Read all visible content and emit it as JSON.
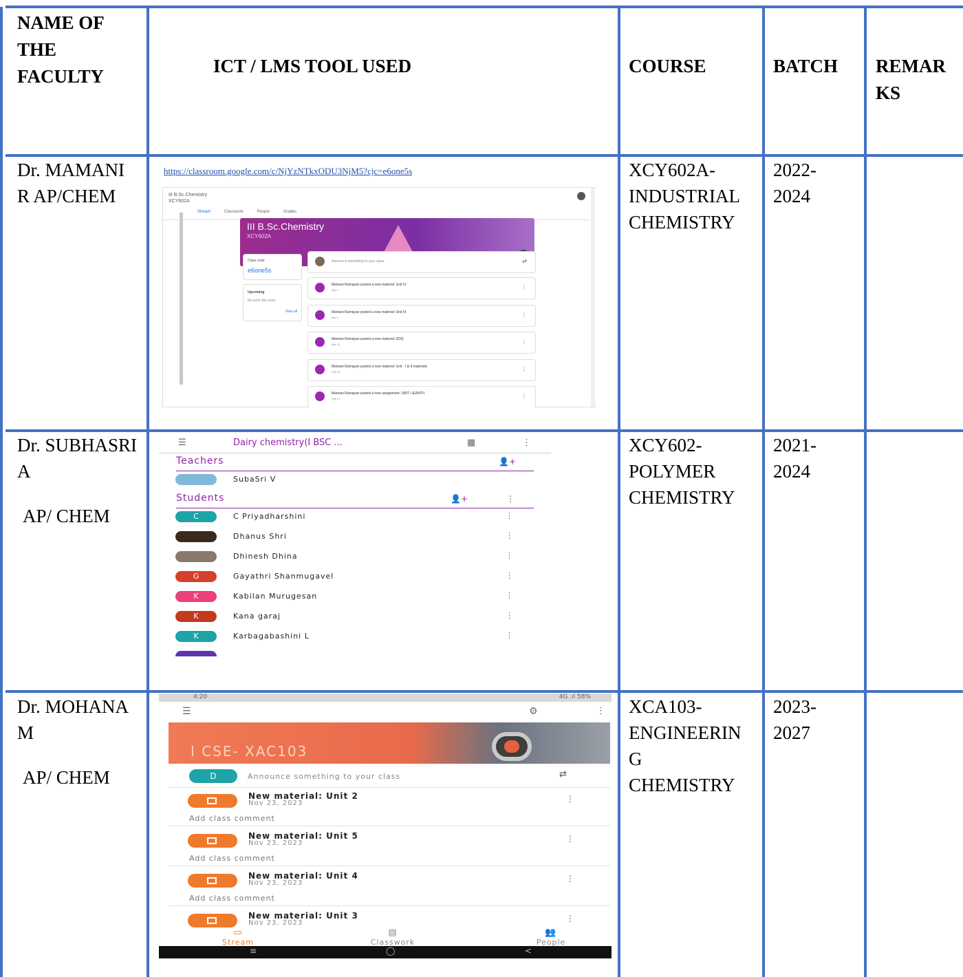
{
  "headers": {
    "faculty": "NAME OF THE FACULTY",
    "tool": "ICT / LMS TOOL USED",
    "course": "COURSE",
    "batch": "BATCH",
    "remarks": "REMAR KS"
  },
  "rows": [
    {
      "faculty_line1": "Dr. MAMANI R AP/CHEM",
      "faculty_line2": "",
      "course": "XCY602A-INDUSTRIAL CHEMISTRY",
      "batch": "2022-2024",
      "remarks": ""
    },
    {
      "faculty_line1": "Dr. SUBHASRI A",
      "faculty_line2": "AP/ CHEM",
      "course": "XCY602-POLYMER CHEMISTRY",
      "batch": "2021-2024",
      "remarks": ""
    },
    {
      "faculty_line1": "Dr. MOHANA M",
      "faculty_line2": "AP/ CHEM",
      "course": "XCA103-ENGINEERIN G CHEMISTRY",
      "batch": "2023-2027",
      "remarks": ""
    }
  ],
  "shot1": {
    "url": "https://classroom.google.com/c/NjYzNTkxODU3NjM5?cjc=e6one5s",
    "class_top": "III B.Sc.Chemistry",
    "class_top_code": "XCY602A",
    "tabs": [
      "Stream",
      "Classwork",
      "People",
      "Grades"
    ],
    "banner_title": "III B.Sc.Chemistry",
    "banner_code": "XCY602A",
    "class_code_label": "Class code",
    "class_code": "e6one5s",
    "upcoming_label": "Upcoming",
    "upcoming_note": "No work due soon",
    "view_all": "View all",
    "announce": "Announce something to your class",
    "posts": [
      {
        "text": "Mamani Ramayan posted a new material: Unit IV",
        "date": "Apr 2"
      },
      {
        "text": "Mamani Ramayan posted a new material: Unit III",
        "date": "Apr 2"
      },
      {
        "text": "Mamani Ramayan posted a new material: DDQ",
        "date": "Mar 21"
      },
      {
        "text": "Mamani Ramayan posted a new material: Unit - I & II materials",
        "date": "Feb 20"
      },
      {
        "text": "Mamani Ramayan posted a new assignment: UNIT I &UNITII",
        "date": "Feb 17"
      }
    ]
  },
  "shot2": {
    "title": "Dairy chemistry(I BSC ...",
    "teachers_label": "Teachers",
    "teacher": "SubaSri V",
    "students_label": "Students",
    "students": [
      {
        "initial": "C",
        "name": "C Priyadharshini",
        "color": "#1ea3a6"
      },
      {
        "initial": "",
        "name": "Dhanus Shri",
        "color": "#3a2a1e"
      },
      {
        "initial": "",
        "name": "Dhinesh Dhina",
        "color": "#8a7a6e"
      },
      {
        "initial": "G",
        "name": "Gayathri Shanmugavel",
        "color": "#d5402b"
      },
      {
        "initial": "K",
        "name": "Kabilan Murugesan",
        "color": "#ec407a"
      },
      {
        "initial": "K",
        "name": "Kana garaj",
        "color": "#c43a1e"
      },
      {
        "initial": "K",
        "name": "Karbagabashini L",
        "color": "#1ea3a6"
      }
    ]
  },
  "shot3": {
    "time": "4:20",
    "status_right": "4G .ıl 58%",
    "banner_title": "I CSE- XAC103",
    "avatar_initial": "D",
    "announce": "Announce something to your class",
    "posts": [
      {
        "title": "New material: Unit 2",
        "date": "Nov 23, 2023",
        "comment": "Add class comment"
      },
      {
        "title": "New material: Unit 5",
        "date": "Nov 23, 2023",
        "comment": "Add class comment"
      },
      {
        "title": "New material: Unit 4",
        "date": "Nov 23, 2023",
        "comment": "Add class comment"
      },
      {
        "title": "New material: Unit 3",
        "date": "Nov 23, 2023",
        "comment": ""
      }
    ],
    "nav": [
      "Stream",
      "Classwork",
      "People"
    ]
  }
}
